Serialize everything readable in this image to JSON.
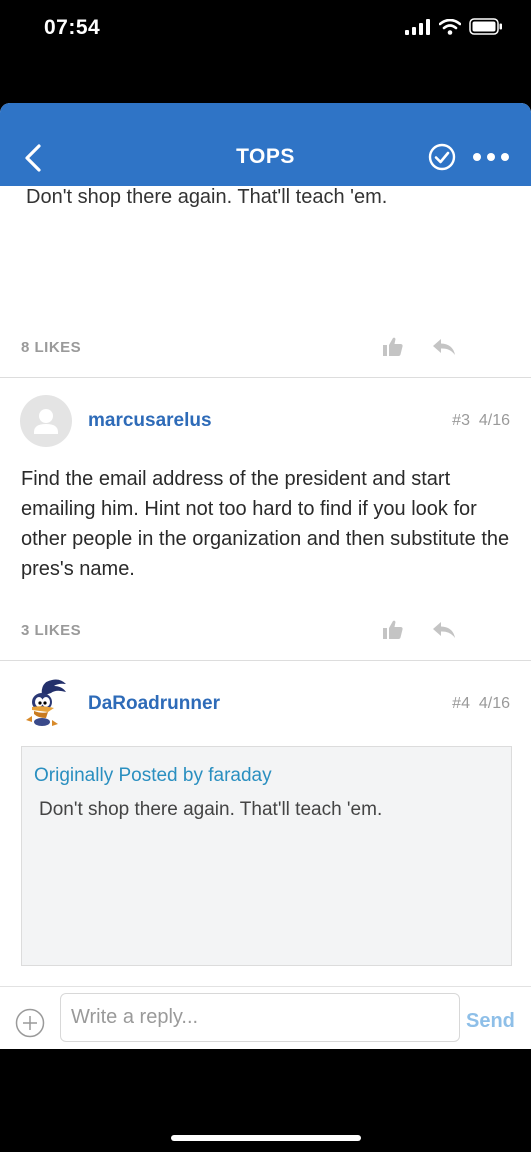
{
  "status_bar": {
    "time": "07:54"
  },
  "nav": {
    "title": "TOPS"
  },
  "previous_post": {
    "text_fragment": "Don't shop there again. That'll teach 'em.",
    "likes": "8 LIKES"
  },
  "posts": [
    {
      "username": "marcusarelus",
      "number": "#3",
      "date": "4/16",
      "body": " Find the email address of the president and start emailing him.  Hint not too hard to find if you look for other people in the organization and then substitute the pres's name.",
      "likes": "3 LIKES"
    },
    {
      "username": "DaRoadrunner",
      "number": "#4",
      "date": "4/16",
      "quote": {
        "header": "Originally Posted by faraday",
        "text": "Don't shop there again. That'll teach 'em."
      }
    }
  ],
  "reply_bar": {
    "placeholder": "Write a reply...",
    "value": "",
    "send_label": "Send"
  },
  "colors": {
    "nav_bg": "#2f74c6",
    "username": "#2e6bb8",
    "quote_header": "#2a8fc0",
    "send": "#8ebfe8"
  },
  "icons": [
    "back-chevron-icon",
    "check-circle-icon",
    "more-dots-icon",
    "thumbs-up-icon",
    "reply-arrow-icon",
    "user-placeholder-icon",
    "roadrunner-avatar",
    "plus-circle-icon",
    "signal-icon",
    "wifi-icon",
    "battery-icon"
  ]
}
